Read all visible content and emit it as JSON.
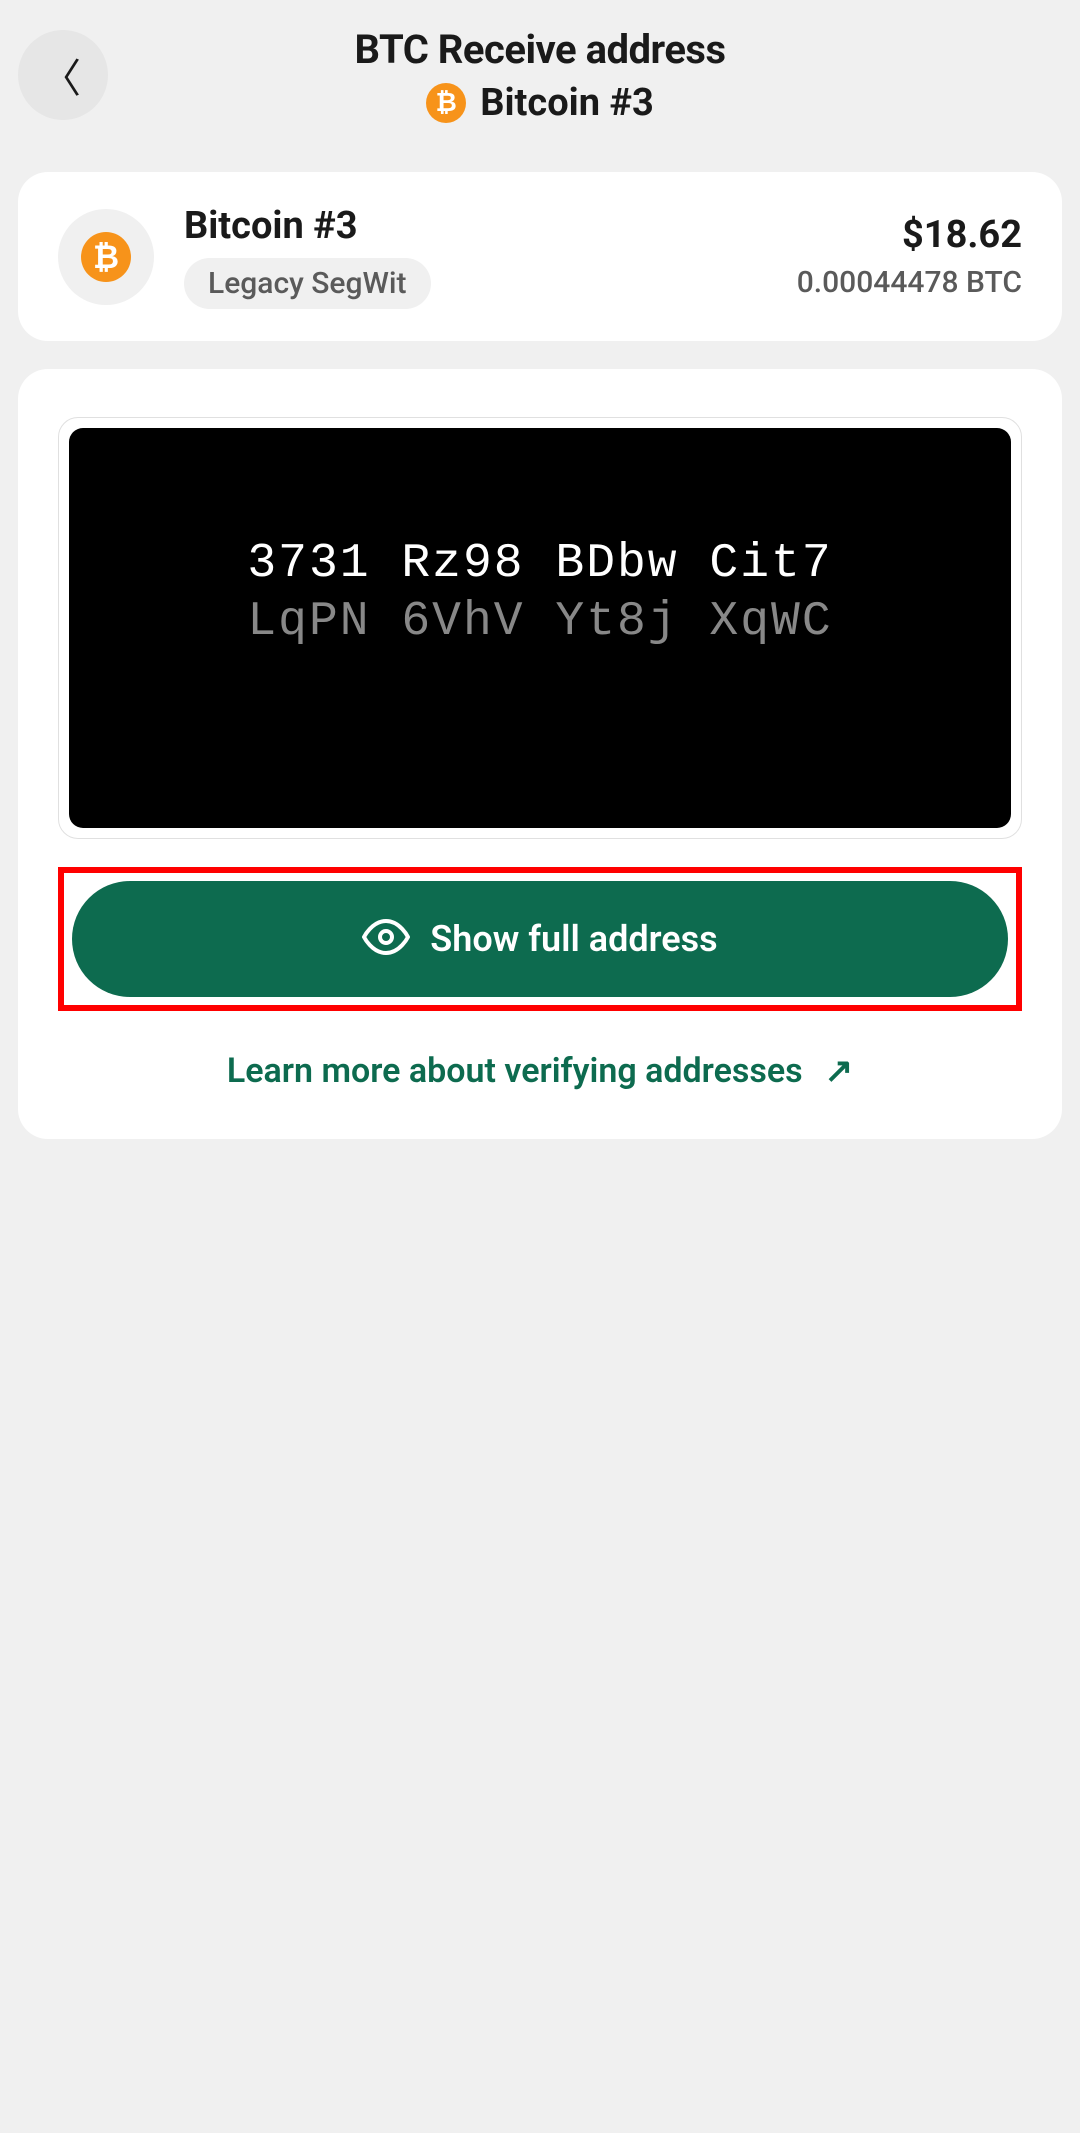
{
  "header": {
    "title": "BTC Receive address",
    "subtitle": "Bitcoin #3",
    "btc_symbol": "₿"
  },
  "account": {
    "name": "Bitcoin #3",
    "type_badge": "Legacy SegWit",
    "fiat_value": "$18.62",
    "crypto_value": "0.00044478 BTC",
    "btc_symbol": "₿"
  },
  "address": {
    "line1": "3731 Rz98 BDbw Cit7",
    "line2": "LqPN 6VhV Yt8j XqWC"
  },
  "actions": {
    "show_button_label": "Show full address",
    "learn_more_label": "Learn more about verifying addresses",
    "arrow": "↗"
  }
}
